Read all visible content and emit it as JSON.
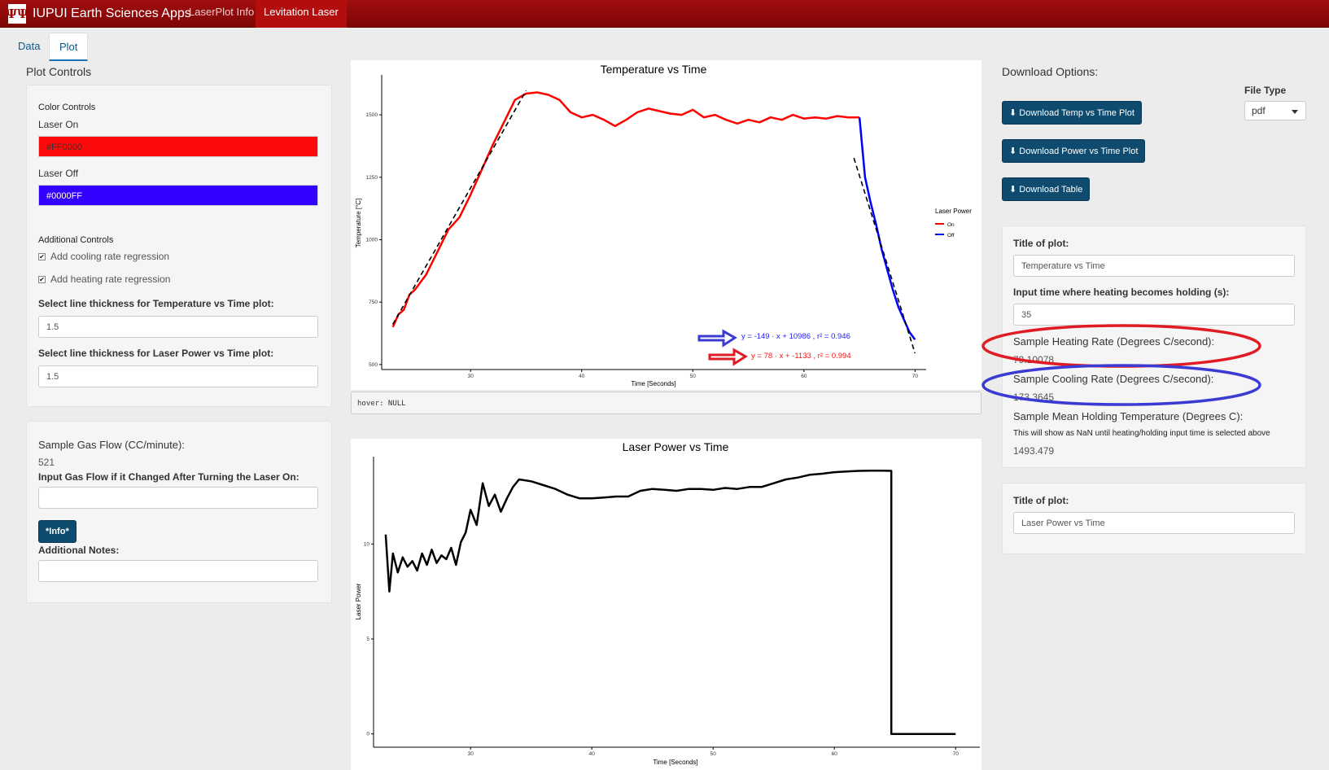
{
  "navbar": {
    "app_title": "IUPUI Earth Sciences Apps",
    "logo_text": "ΨΨ",
    "links": [
      "LaserPlot Info",
      "Levitation Laser"
    ]
  },
  "tabs": [
    "Data",
    "Plot"
  ],
  "plot_controls": {
    "title": "Plot Controls",
    "color_controls_label": "Color Controls",
    "laser_on_label": "Laser On",
    "laser_on_value": "#FF0000",
    "laser_off_label": "Laser Off",
    "laser_off_value": "#0000FF",
    "additional_controls_label": "Additional Controls",
    "cooling_regression_label": "Add cooling rate regression",
    "heating_regression_label": "Add heating rate regression",
    "temp_thickness_label": "Select line thickness for Temperature vs Time plot:",
    "temp_thickness_value": "1.5",
    "power_thickness_label": "Select line thickness for Laser Power vs Time plot:",
    "power_thickness_value": "1.5"
  },
  "gas_panel": {
    "gas_flow_label": "Sample Gas Flow (CC/minute):",
    "gas_flow_value": "521",
    "gas_flow_input_label": "Input Gas Flow if it Changed After Turning the Laser On:",
    "info_button": "*Info*",
    "notes_label": "Additional Notes:"
  },
  "download": {
    "title": "Download Options:",
    "file_type_label": "File Type",
    "file_type_value": "pdf",
    "temp_button": "Download Temp vs Time Plot",
    "power_button": "Download Power vs Time Plot",
    "table_button": "Download Table"
  },
  "temp_panel": {
    "title_label": "Title of plot:",
    "title_value": "Temperature vs Time",
    "holding_label": "Input time where heating becomes holding (s):",
    "holding_value": "35",
    "heating_rate_label": "Sample Heating Rate (Degrees C/second):",
    "heating_rate_value": "79.10078",
    "cooling_rate_label": "Sample Cooling Rate (Degrees C/second):",
    "cooling_rate_value": "173.3645",
    "holding_temp_label": "Sample Mean Holding Temperature (Degrees C):",
    "holding_temp_note": "This will show as NaN until heating/holding input time is selected above",
    "holding_temp_value": "1493.479"
  },
  "power_panel": {
    "title_label": "Title of plot:",
    "title_value": "Laser Power vs Time"
  },
  "hover_text": "hover: NULL",
  "colors": {
    "laser_on": "#FF0000",
    "laser_off": "#0000FF",
    "navbar": "#8b0a0a",
    "button": "#0f4b6e",
    "heating_circle": "#e01b24",
    "cooling_circle": "#3b3bd4"
  },
  "chart_data": [
    {
      "type": "line",
      "title": "Temperature vs Time",
      "xlabel": "Time [Seconds]",
      "ylabel": "Temperature [°C]",
      "xlim": [
        22,
        71
      ],
      "ylim": [
        480,
        1660
      ],
      "xticks": [
        30,
        40,
        50,
        60,
        70
      ],
      "yticks": [
        500,
        750,
        1000,
        1250,
        1500
      ],
      "legend_title": "Laser Power",
      "series": [
        {
          "name": "On",
          "color": "#FF0000",
          "x": [
            23,
            23.5,
            24,
            24.5,
            25,
            26,
            27,
            28,
            29,
            30,
            31,
            32,
            33,
            34,
            35,
            36,
            37,
            38,
            39,
            40,
            41,
            42,
            43,
            44,
            45,
            46,
            47,
            48,
            49,
            50,
            51,
            52,
            53,
            54,
            55,
            56,
            57,
            58,
            59,
            60,
            61,
            62,
            63,
            64,
            65
          ],
          "y": [
            650,
            700,
            720,
            780,
            800,
            860,
            950,
            1040,
            1090,
            1180,
            1280,
            1380,
            1470,
            1560,
            1585,
            1590,
            1580,
            1560,
            1510,
            1490,
            1500,
            1480,
            1455,
            1480,
            1510,
            1525,
            1515,
            1505,
            1500,
            1520,
            1490,
            1500,
            1480,
            1465,
            1480,
            1470,
            1490,
            1480,
            1500,
            1485,
            1490,
            1485,
            1495,
            1490,
            1490
          ]
        },
        {
          "name": "Off",
          "color": "#0000FF",
          "x": [
            65,
            65.5,
            66,
            66.5,
            67,
            67.5,
            68,
            68.5,
            69,
            69.5,
            70
          ],
          "y": [
            1490,
            1250,
            1150,
            1060,
            960,
            880,
            800,
            730,
            680,
            630,
            600
          ]
        }
      ],
      "regressions": [
        {
          "label": "y = -149 · x + 10986 , r² = 0.946",
          "color": "#0000FF",
          "x": [
            64.5,
            70
          ],
          "y": [
            1327,
            545
          ]
        },
        {
          "label": "y = 78 · x + -1133 , r² = 0.994",
          "color": "#FF0000",
          "x": [
            23,
            35
          ],
          "y": [
            661,
            1597
          ]
        }
      ]
    },
    {
      "type": "line",
      "title": "Laser Power vs Time",
      "xlabel": "Time [Seconds]",
      "ylabel": "Laser Power",
      "xlim": [
        22,
        72
      ],
      "ylim": [
        -0.7,
        14.6
      ],
      "xticks": [
        30,
        40,
        50,
        60,
        70
      ],
      "yticks": [
        0,
        5,
        10
      ],
      "series": [
        {
          "name": "",
          "color": "#000000",
          "x": [
            23,
            23.3,
            23.6,
            24,
            24.4,
            24.8,
            25.2,
            25.6,
            26,
            26.4,
            26.8,
            27.2,
            27.6,
            28,
            28.4,
            28.8,
            29.2,
            29.6,
            30,
            30.5,
            31,
            31.5,
            32,
            32.5,
            33,
            33.5,
            34,
            35,
            36,
            37,
            38,
            39,
            40,
            41,
            42,
            43,
            44,
            45,
            46,
            47,
            48,
            49,
            50,
            51,
            52,
            53,
            54,
            55,
            56,
            57,
            58,
            59,
            60,
            61,
            62,
            63,
            64,
            64.7,
            64.7,
            65,
            70
          ],
          "y": [
            10.5,
            7.5,
            9.5,
            8.5,
            9.3,
            8.8,
            9.1,
            8.6,
            9.5,
            8.9,
            9.7,
            9.0,
            9.4,
            9.2,
            9.8,
            8.9,
            10.1,
            10.6,
            11.8,
            11.0,
            13.2,
            12.0,
            12.6,
            11.7,
            12.4,
            13.0,
            13.4,
            13.3,
            13.1,
            12.9,
            12.6,
            12.4,
            12.4,
            12.45,
            12.5,
            12.5,
            12.8,
            12.9,
            12.85,
            12.8,
            12.9,
            12.9,
            12.85,
            12.95,
            12.9,
            13.0,
            13.0,
            13.2,
            13.4,
            13.5,
            13.65,
            13.7,
            13.78,
            13.82,
            13.85,
            13.86,
            13.86,
            13.85,
            0,
            0,
            0
          ]
        }
      ]
    }
  ]
}
